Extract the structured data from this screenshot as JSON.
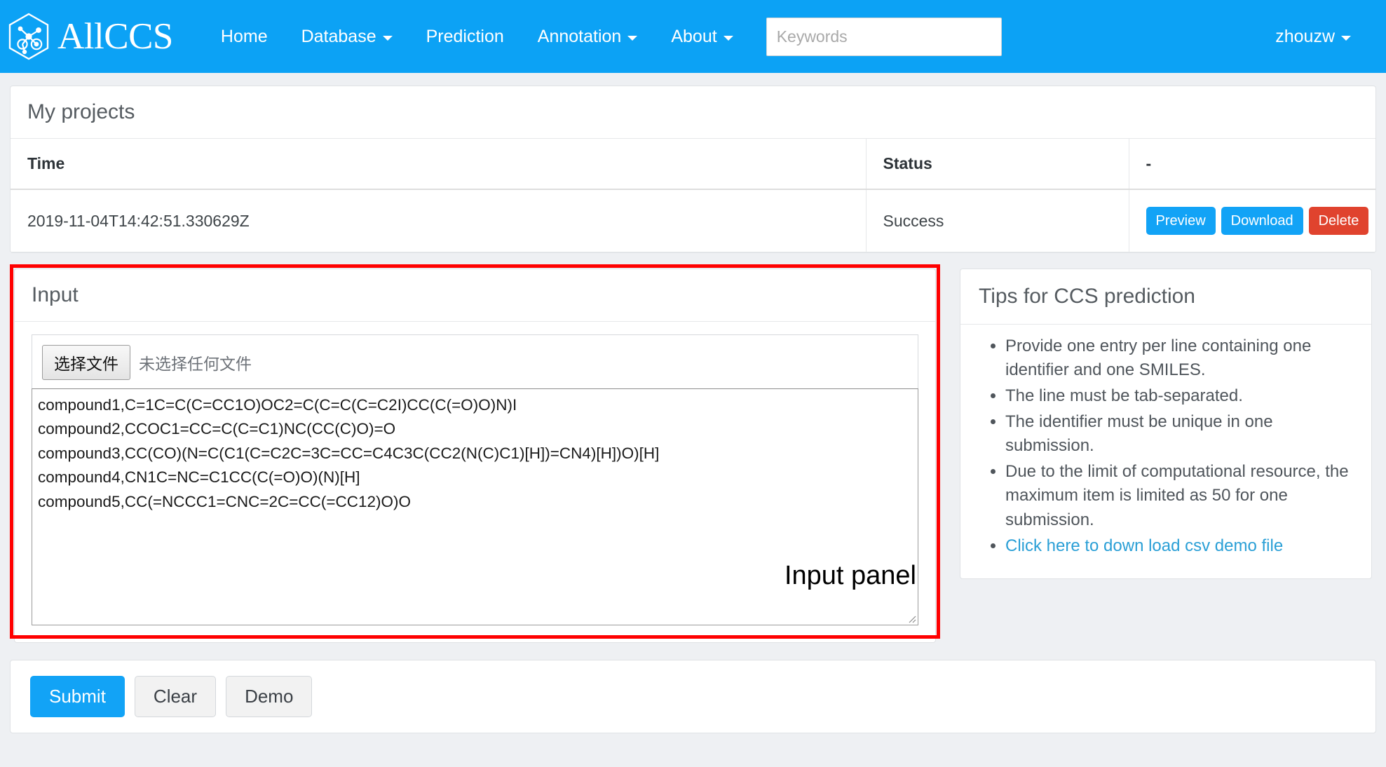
{
  "navbar": {
    "brand": "AllCCS",
    "brand_logo_icon": "hexagon-molecule-logo-icon",
    "items": [
      {
        "label": "Home",
        "caret": false
      },
      {
        "label": "Database",
        "caret": true
      },
      {
        "label": "Prediction",
        "caret": false
      },
      {
        "label": "Annotation",
        "caret": true
      },
      {
        "label": "About",
        "caret": true
      }
    ],
    "search_placeholder": "Keywords",
    "search_value": "",
    "search_icon": "search-icon",
    "user": "zhouzw",
    "user_caret": true,
    "bg_color": "#0CA2F5"
  },
  "projects": {
    "title": "My projects",
    "columns": [
      "Time",
      "Status",
      "-"
    ],
    "rows": [
      {
        "time": "2019-11-04T14:42:51.330629Z",
        "status": "Success",
        "actions": [
          {
            "label": "Preview",
            "style": "blue"
          },
          {
            "label": "Download",
            "style": "blue"
          },
          {
            "label": "Delete",
            "style": "red"
          }
        ]
      }
    ]
  },
  "input_panel": {
    "title": "Input",
    "file_button_label": "选择文件",
    "file_status_label": "未选择任何文件",
    "textarea_value": "compound1,C=1C=C(C=CC1O)OC2=C(C=C(C=C2I)CC(C(=O)O)N)I\ncompound2,CCOC1=CC=C(C=C1)NC(CC(C)O)=O\ncompound3,CC(CO)(N=C(C1(C=C2C=3C=CC=C4C3C(CC2(N(C)C1)[H])=CN4)[H])O)[H]\ncompound4,CN1C=NC=C1CC(C(=O)O)(N)[H]\ncompound5,CC(=NCCC1=CNC=2C=CC(=CC12)O)O",
    "annotation_label": "Input panel",
    "annotation_color": "#FF0000"
  },
  "tips": {
    "title": "Tips for CCS prediction",
    "items": [
      "Provide one entry per line containing one identifier and one SMILES.",
      "The line must be tab-separated.",
      "The identifier must be unique in one submission.",
      "Due to the limit of computational resource, the maximum item is limited as 50 for one submission."
    ],
    "link_item": "Click here to down load csv demo file",
    "link_color": "#2a9fd6"
  },
  "footer": {
    "submit_label": "Submit",
    "clear_label": "Clear",
    "demo_label": "Demo"
  }
}
